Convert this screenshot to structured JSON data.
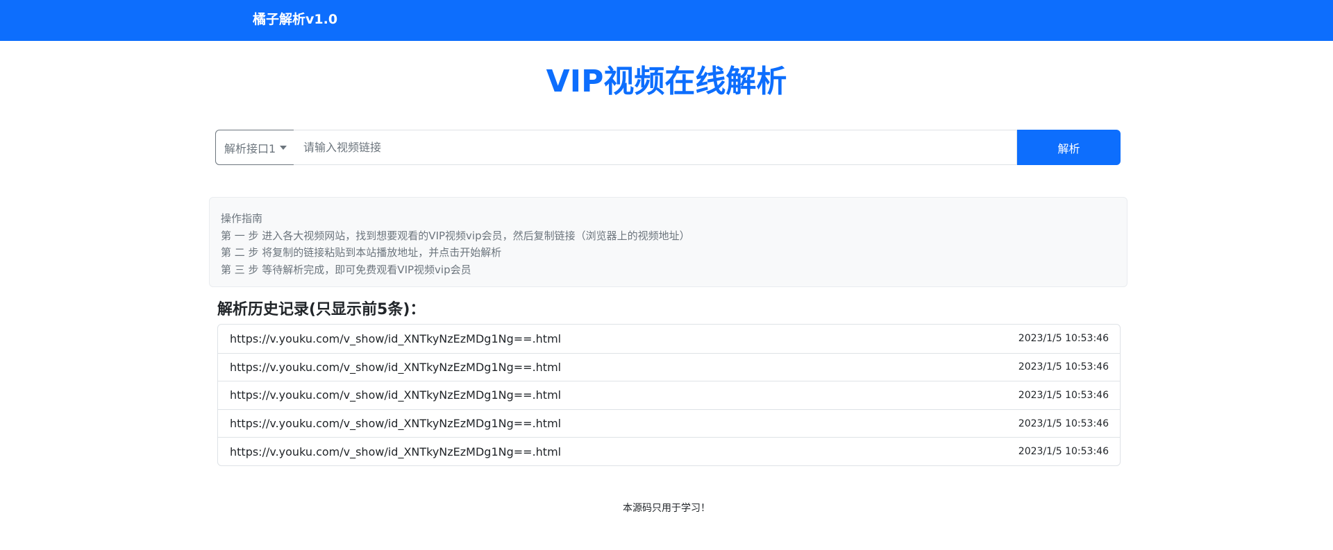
{
  "navbar": {
    "brand": "橘子解析v1.0"
  },
  "main": {
    "title": "VIP视频在线解析"
  },
  "search": {
    "interface_selected": "解析接口1",
    "placeholder": "请输入视频链接",
    "value": "",
    "submit_label": "解析"
  },
  "guide": {
    "heading": "操作指南",
    "steps": [
      "第 一 步 进入各大视频网站，找到想要观看的VIP视频vip会员，然后复制链接（浏览器上的视频地址）",
      "第 二 步 将复制的链接粘贴到本站播放地址，并点击开始解析",
      "第 三 步 等待解析完成，即可免费观看VIP视频vip会员"
    ]
  },
  "history": {
    "title": "解析历史记录(只显示前5条)：",
    "items": [
      {
        "url": "https://v.youku.com/v_show/id_XNTkyNzEzMDg1Ng==.html",
        "time": "2023/1/5 10:53:46"
      },
      {
        "url": "https://v.youku.com/v_show/id_XNTkyNzEzMDg1Ng==.html",
        "time": "2023/1/5 10:53:46"
      },
      {
        "url": "https://v.youku.com/v_show/id_XNTkyNzEzMDg1Ng==.html",
        "time": "2023/1/5 10:53:46"
      },
      {
        "url": "https://v.youku.com/v_show/id_XNTkyNzEzMDg1Ng==.html",
        "time": "2023/1/5 10:53:46"
      },
      {
        "url": "https://v.youku.com/v_show/id_XNTkyNzEzMDg1Ng==.html",
        "time": "2023/1/5 10:53:46"
      }
    ]
  },
  "footer": {
    "note": "本源码只用于学习！"
  },
  "colors": {
    "primary": "#0d6efd",
    "muted": "#6c757d",
    "guide_bg": "#f8f9fa"
  },
  "icons": {
    "select_caret": "caret-down-icon"
  }
}
